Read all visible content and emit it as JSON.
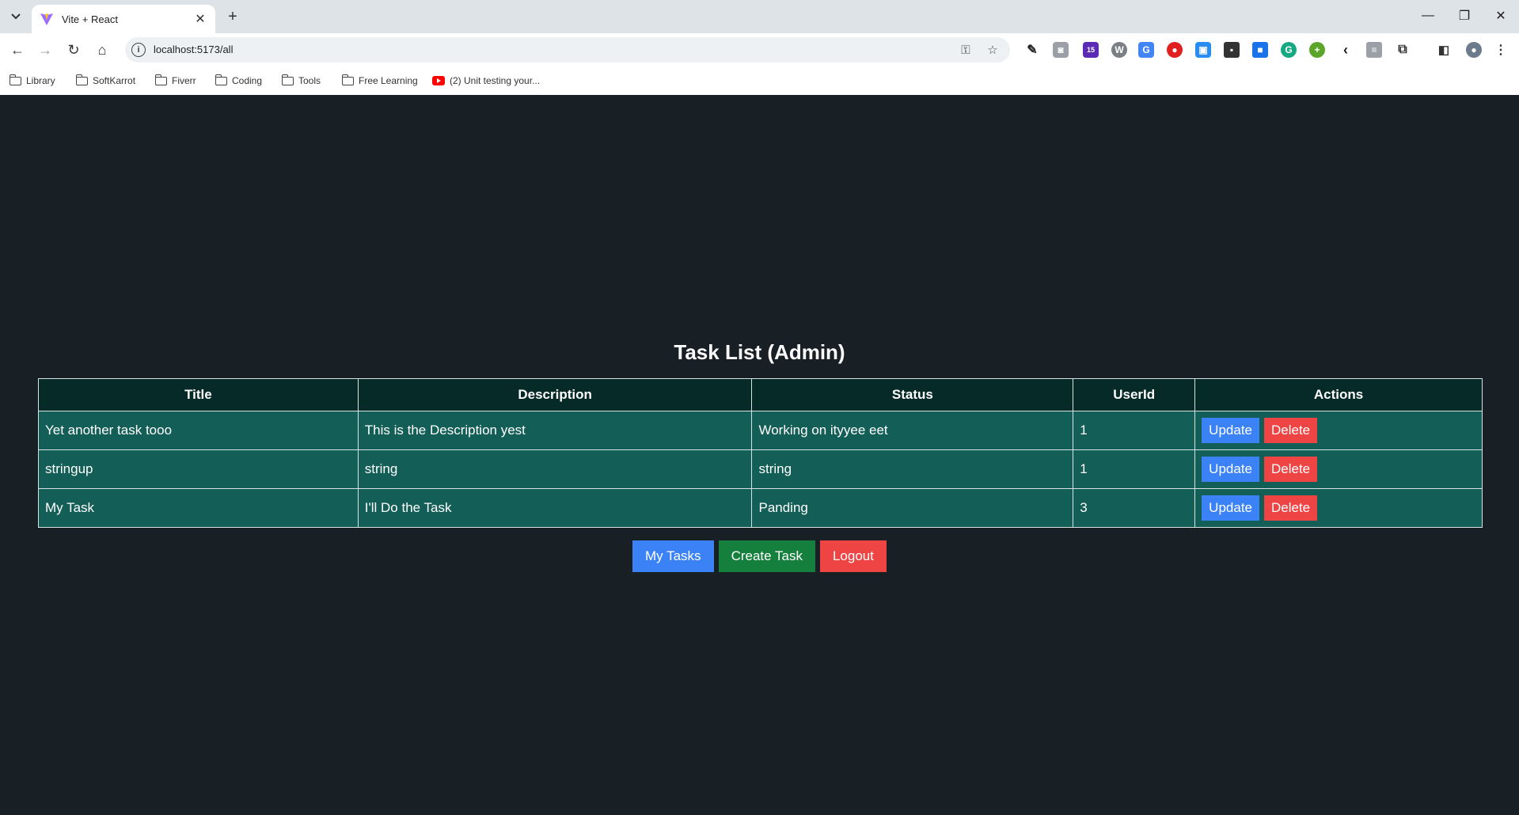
{
  "browser": {
    "tab_title": "Vite + React",
    "url": "localhost:5173/all",
    "bookmarks": [
      "Library",
      "SoftKarrot",
      "Fiverr",
      "Coding",
      "Tools",
      "Free Learning",
      "(2) Unit testing your..."
    ],
    "extension_badge": "15"
  },
  "page": {
    "title": "Task List (Admin)",
    "columns": [
      "Title",
      "Description",
      "Status",
      "UserId",
      "Actions"
    ],
    "rows": [
      {
        "title": "Yet another task tooo",
        "description": "This is the Description yest",
        "status": "Working on ityyee eet",
        "user_id": "1"
      },
      {
        "title": "stringup",
        "description": "string",
        "status": "string",
        "user_id": "1"
      },
      {
        "title": "My Task",
        "description": "I'll Do the Task",
        "status": "Panding",
        "user_id": "3"
      }
    ],
    "row_actions": {
      "update": "Update",
      "delete": "Delete"
    },
    "buttons": {
      "my_tasks": "My Tasks",
      "create_task": "Create Task",
      "logout": "Logout"
    }
  },
  "colors": {
    "background": "#182026",
    "header_row": "#062a27",
    "body_row": "#135e56",
    "primary": "#3b82f6",
    "success": "#15803d",
    "danger": "#ef4444"
  }
}
